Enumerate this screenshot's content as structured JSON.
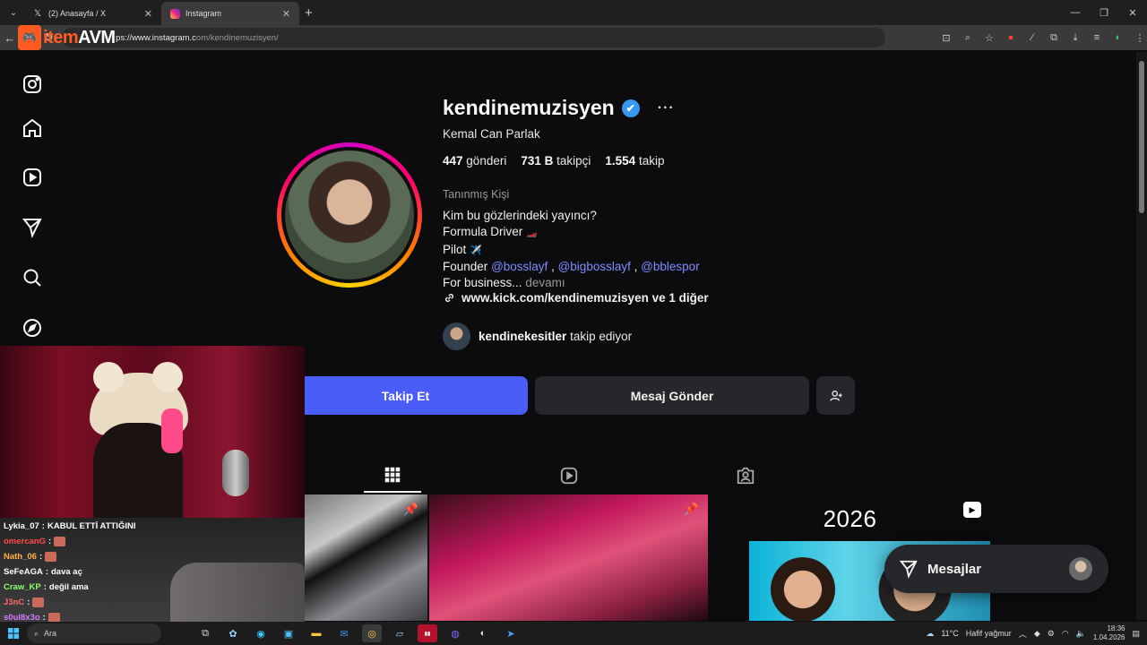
{
  "browser": {
    "tabs": [
      {
        "title": "(2) Anasayfa / X",
        "icon": "x-logo-icon",
        "active": false
      },
      {
        "title": "Instagram",
        "icon": "instagram-icon",
        "active": true
      }
    ],
    "url_visible_path": "om/kendinemuzisyen/",
    "url_host": "ps://www.instagram.c"
  },
  "overlay": {
    "logo_text_a": "item",
    "logo_text_b": "AVM"
  },
  "sidebar": {
    "items": [
      {
        "name": "instagram-logo-icon"
      },
      {
        "name": "home-icon"
      },
      {
        "name": "reels-icon"
      },
      {
        "name": "direct-send-icon"
      },
      {
        "name": "search-icon"
      },
      {
        "name": "explore-compass-icon"
      }
    ]
  },
  "profile": {
    "username": "kendinemuzisyen",
    "verified_mark": "✔",
    "more": "···",
    "full_name": "Kemal Can Parlak",
    "stats": {
      "posts_value": "447",
      "posts_label": "gönderi",
      "followers_value": "731 B",
      "followers_label": "takipçi",
      "following_value": "1.554",
      "following_label": "takip"
    },
    "category": "Tanınmış Kişi",
    "bio": {
      "line1": "Kim bu gözlerindeki yayıncı?",
      "line2": "Formula Driver",
      "line2_emoji": "🏎️",
      "line3": "Pilot",
      "line3_emoji": "✈️",
      "line4_prefix": "Founder",
      "mention1": "@bosslayf",
      "mention2": "@bigbosslayf",
      "mention3": "@bblespor",
      "sep": ",",
      "line5": "For business...",
      "more_label": "devamı"
    },
    "link_text": "www.kick.com/kendinemuzisyen ve 1 diğer",
    "followed_by_user": "kendinekesitler",
    "followed_by_suffix": "takip ediyor",
    "follow_button": "Takip Et",
    "message_button": "Mesaj Gönder"
  },
  "posts": {
    "post3_year": "2026"
  },
  "messages_float": {
    "label": "Mesajlar"
  },
  "chat": [
    {
      "user": "Lykia_07",
      "sep": ":",
      "text": "KABUL ETTİ ATTIĞINI",
      "color": "#ffffff",
      "emote": false
    },
    {
      "user": "omercanG",
      "sep": ":",
      "text": "",
      "color": "#ff4b4b",
      "emote": true
    },
    {
      "user": "Nath_06",
      "sep": ":",
      "text": "",
      "color": "#ffb347",
      "emote": true
    },
    {
      "user": "SeFeAGA",
      "sep": ":",
      "text": "dava aç",
      "color": "#ffffff",
      "emote": false
    },
    {
      "user": "Craw_KP",
      "sep": ":",
      "text": "değil ama",
      "color": "#8cff6a",
      "emote": false
    },
    {
      "user": "J3nC",
      "sep": ":",
      "text": "",
      "color": "#ff6b6b",
      "emote": true
    },
    {
      "user": "s0ul8x3o",
      "sep": ":",
      "text": "",
      "color": "#d17bff",
      "emote": true
    }
  ],
  "taskbar": {
    "search_placeholder": "Ara",
    "weather_temp": "11°C",
    "weather_text": "Hafif yağmur",
    "time": "18:36",
    "date": "1.04.2026"
  },
  "colors": {
    "follow_button": "#4a5df9",
    "mention": "#7f8cff",
    "verified": "#3897f0",
    "background": "#0c0c0e"
  }
}
